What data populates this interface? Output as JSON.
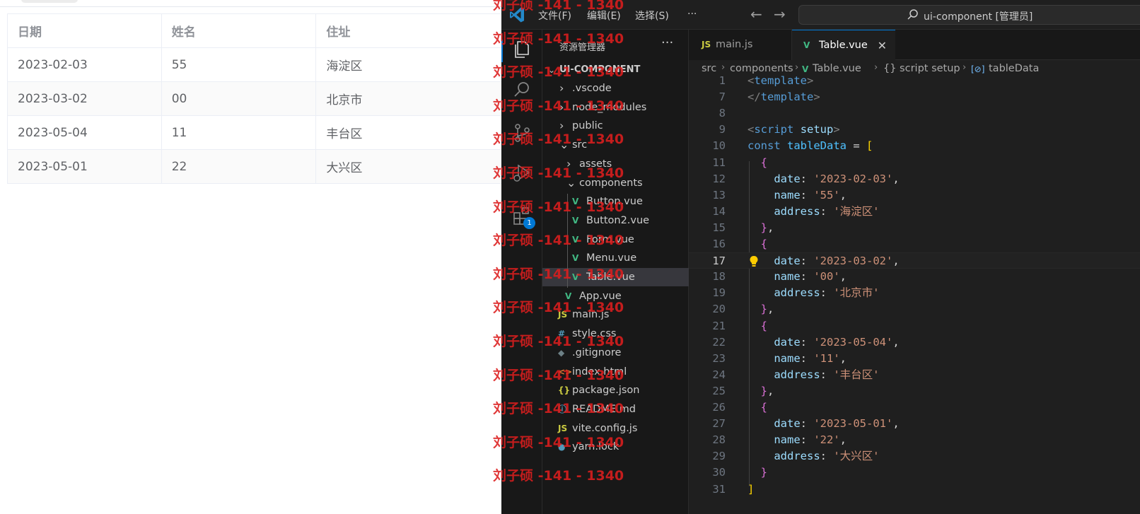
{
  "browser": {
    "table": {
      "headers": [
        "日期",
        "姓名",
        "住址"
      ],
      "rows": [
        [
          "2023-02-03",
          "55",
          "海淀区"
        ],
        [
          "2023-03-02",
          "00",
          "北京市"
        ],
        [
          "2023-05-04",
          "11",
          "丰台区"
        ],
        [
          "2023-05-01",
          "22",
          "大兴区"
        ]
      ]
    }
  },
  "vscode": {
    "menu": [
      "文件(F)",
      "编辑(E)",
      "选择(S)",
      "···"
    ],
    "command_center": "ui-component [管理员]",
    "activity_badge": "1",
    "explorer": {
      "title": "资源管理器",
      "more": "···",
      "root": "UI-COMPONENT",
      "items": [
        {
          "label": ".vscode",
          "chevron": "›",
          "icon": ""
        },
        {
          "label": "node_modules",
          "chevron": "›",
          "icon": ""
        },
        {
          "label": "public",
          "chevron": "›",
          "icon": ""
        },
        {
          "label": "src",
          "chevron": "⌄",
          "icon": ""
        },
        {
          "label": "assets",
          "chevron": "›",
          "icon": ""
        },
        {
          "label": "components",
          "chevron": "⌄",
          "icon": ""
        },
        {
          "label": "Button.vue",
          "chevron": "",
          "icon": "V"
        },
        {
          "label": "Button2.vue",
          "chevron": "",
          "icon": "V"
        },
        {
          "label": "Form.vue",
          "chevron": "",
          "icon": "V"
        },
        {
          "label": "Menu.vue",
          "chevron": "",
          "icon": "V"
        },
        {
          "label": "Table.vue",
          "chevron": "",
          "icon": "V"
        },
        {
          "label": "App.vue",
          "chevron": "",
          "icon": "V"
        },
        {
          "label": "main.js",
          "chevron": "",
          "icon": "JS"
        },
        {
          "label": "style.css",
          "chevron": "",
          "icon": "#"
        },
        {
          "label": ".gitignore",
          "chevron": "",
          "icon": "◆"
        },
        {
          "label": "index.html",
          "chevron": "",
          "icon": "<>"
        },
        {
          "label": "package.json",
          "chevron": "",
          "icon": "{}"
        },
        {
          "label": "README.md",
          "chevron": "",
          "icon": "ⓘ"
        },
        {
          "label": "vite.config.js",
          "chevron": "",
          "icon": "JS"
        },
        {
          "label": "yarn.lock",
          "chevron": "",
          "icon": "●"
        }
      ]
    },
    "tabs": [
      {
        "label": "main.js",
        "icon": "JS"
      },
      {
        "label": "Table.vue",
        "icon": "V",
        "close": "✕"
      }
    ],
    "breadcrumb": [
      "src",
      "components",
      "Table.vue",
      "{} script setup",
      "tableData"
    ],
    "code": {
      "line_numbers": [
        "1",
        "7",
        "8",
        "9",
        "10",
        "11",
        "12",
        "13",
        "14",
        "15",
        "16",
        "17",
        "18",
        "19",
        "20",
        "21",
        "22",
        "23",
        "24",
        "25",
        "26",
        "27",
        "28",
        "29",
        "30",
        "31"
      ],
      "current_line": "17",
      "lines": [
        [
          [
            "t-bracket",
            "<"
          ],
          [
            "t-tag",
            "template"
          ],
          [
            "t-bracket",
            ">"
          ]
        ],
        [
          [
            "t-bracket",
            "</"
          ],
          [
            "t-tag",
            "template"
          ],
          [
            "t-bracket",
            ">"
          ]
        ],
        [],
        [
          [
            "t-bracket",
            "<"
          ],
          [
            "t-tag",
            "script"
          ],
          [
            "t-op",
            " "
          ],
          [
            "t-attr",
            "setup"
          ],
          [
            "t-bracket",
            ">"
          ]
        ],
        [
          [
            "t-kw",
            "const"
          ],
          [
            "t-op",
            " "
          ],
          [
            "t-var",
            "tableData"
          ],
          [
            "t-op",
            " = "
          ],
          [
            "t-b1",
            "["
          ]
        ],
        [
          [
            "t-op",
            "  "
          ],
          [
            "t-b2",
            "{"
          ]
        ],
        [
          [
            "t-op",
            "    "
          ],
          [
            "t-prop",
            "date"
          ],
          [
            "t-op",
            ": "
          ],
          [
            "t-str",
            "'2023-02-03'"
          ],
          [
            "t-op",
            ","
          ]
        ],
        [
          [
            "t-op",
            "    "
          ],
          [
            "t-prop",
            "name"
          ],
          [
            "t-op",
            ": "
          ],
          [
            "t-str",
            "'55'"
          ],
          [
            "t-op",
            ","
          ]
        ],
        [
          [
            "t-op",
            "    "
          ],
          [
            "t-prop",
            "address"
          ],
          [
            "t-op",
            ": "
          ],
          [
            "t-str",
            "'海淀区'"
          ]
        ],
        [
          [
            "t-op",
            "  "
          ],
          [
            "t-b2",
            "}"
          ],
          [
            "t-op",
            ","
          ]
        ],
        [
          [
            "t-op",
            "  "
          ],
          [
            "t-b2",
            "{"
          ]
        ],
        [
          [
            "t-op",
            "    "
          ],
          [
            "t-prop",
            "date"
          ],
          [
            "t-op",
            ": "
          ],
          [
            "t-str",
            "'2023-03-02'"
          ],
          [
            "t-op",
            ","
          ]
        ],
        [
          [
            "t-op",
            "    "
          ],
          [
            "t-prop",
            "name"
          ],
          [
            "t-op",
            ": "
          ],
          [
            "t-str",
            "'00'"
          ],
          [
            "t-op",
            ","
          ]
        ],
        [
          [
            "t-op",
            "    "
          ],
          [
            "t-prop",
            "address"
          ],
          [
            "t-op",
            ": "
          ],
          [
            "t-str",
            "'北京市'"
          ]
        ],
        [
          [
            "t-op",
            "  "
          ],
          [
            "t-b2",
            "}"
          ],
          [
            "t-op",
            ","
          ]
        ],
        [
          [
            "t-op",
            "  "
          ],
          [
            "t-b2",
            "{"
          ]
        ],
        [
          [
            "t-op",
            "    "
          ],
          [
            "t-prop",
            "date"
          ],
          [
            "t-op",
            ": "
          ],
          [
            "t-str",
            "'2023-05-04'"
          ],
          [
            "t-op",
            ","
          ]
        ],
        [
          [
            "t-op",
            "    "
          ],
          [
            "t-prop",
            "name"
          ],
          [
            "t-op",
            ": "
          ],
          [
            "t-str",
            "'11'"
          ],
          [
            "t-op",
            ","
          ]
        ],
        [
          [
            "t-op",
            "    "
          ],
          [
            "t-prop",
            "address"
          ],
          [
            "t-op",
            ": "
          ],
          [
            "t-str",
            "'丰台区'"
          ]
        ],
        [
          [
            "t-op",
            "  "
          ],
          [
            "t-b2",
            "}"
          ],
          [
            "t-op",
            ","
          ]
        ],
        [
          [
            "t-op",
            "  "
          ],
          [
            "t-b2",
            "{"
          ]
        ],
        [
          [
            "t-op",
            "    "
          ],
          [
            "t-prop",
            "date"
          ],
          [
            "t-op",
            ": "
          ],
          [
            "t-str",
            "'2023-05-01'"
          ],
          [
            "t-op",
            ","
          ]
        ],
        [
          [
            "t-op",
            "    "
          ],
          [
            "t-prop",
            "name"
          ],
          [
            "t-op",
            ": "
          ],
          [
            "t-str",
            "'22'"
          ],
          [
            "t-op",
            ","
          ]
        ],
        [
          [
            "t-op",
            "    "
          ],
          [
            "t-prop",
            "address"
          ],
          [
            "t-op",
            ": "
          ],
          [
            "t-str",
            "'大兴区'"
          ]
        ],
        [
          [
            "t-op",
            "  "
          ],
          [
            "t-b2",
            "}"
          ]
        ],
        [
          [
            "t-b1",
            "]"
          ]
        ]
      ]
    }
  },
  "watermark": {
    "text": "刘子硕 -141 - 1340"
  },
  "colors": {
    "accent": "#0078d4",
    "vue_green": "#41b883",
    "js_yellow": "#cbcb41",
    "watermark_red": "#dc1e1e"
  }
}
